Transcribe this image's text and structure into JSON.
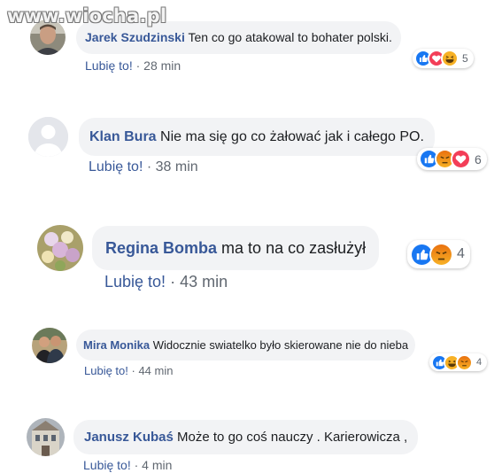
{
  "watermark": "www.wiocha.pl",
  "comments": [
    {
      "author": "Jarek Szudzinski",
      "text": "Ten co go atakowal to bohater polski.",
      "like_label": "Lubię to!",
      "time": "· 28 min",
      "reaction_icons": [
        "like-icon",
        "love-icon",
        "haha-icon"
      ],
      "reaction_count": "5",
      "avatar": "man-photo"
    },
    {
      "author": "Klan Bura",
      "text": "Nie ma się go co żałować jak i całego PO.",
      "like_label": "Lubię to!",
      "time": "· 38 min",
      "reaction_icons": [
        "like-icon",
        "angry-icon",
        "love-icon"
      ],
      "reaction_count": "6",
      "avatar": "default-avatar"
    },
    {
      "author": "Regina Bomba",
      "text": "ma to na co zasłużył",
      "like_label": "Lubię to!",
      "time": "· 43 min",
      "reaction_icons": [
        "like-icon",
        "angry-icon"
      ],
      "reaction_count": "4",
      "avatar": "flowers-photo"
    },
    {
      "author": "Mira Monika",
      "text": "Widocznie swiatelko było skierowane nie do nieba",
      "like_label": "Lubię to!",
      "time": "· 44 min",
      "reaction_icons": [
        "like-icon",
        "haha-icon",
        "angry-icon"
      ],
      "reaction_count": "4",
      "avatar": "couple-photo"
    },
    {
      "author": "Janusz Kubaś",
      "text": "Może to go coś nauczy . Karierowicza ,",
      "like_label": "Lubię to!",
      "time": "· 4 min",
      "reaction_icons": [],
      "reaction_count": "",
      "avatar": "building-photo"
    }
  ],
  "colors": {
    "author": "#385898",
    "bubble": "#f2f3f5",
    "meta": "#606770",
    "like_blue": "#1877f2",
    "love_red": "#f33e58",
    "haha_yellow": "#f7b125"
  }
}
